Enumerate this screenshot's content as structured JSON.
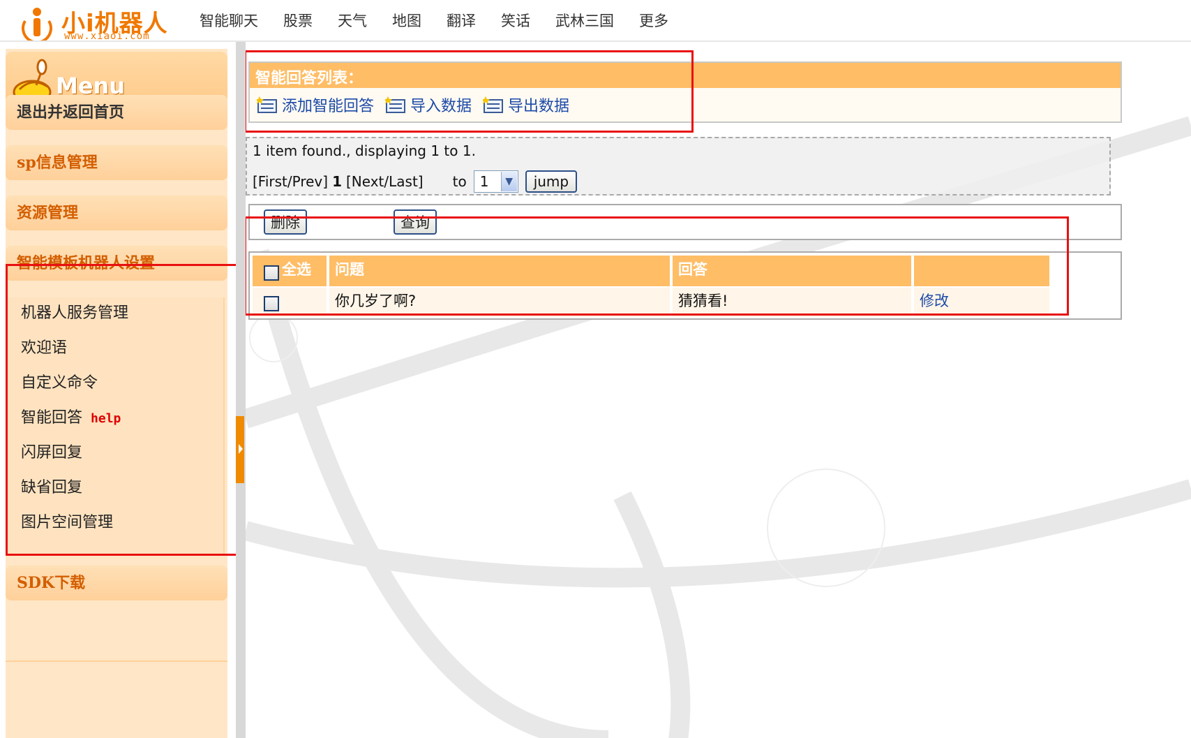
{
  "brand": {
    "name": "小i机器人",
    "url": "www.xiaoi.com",
    "color": "#f07800"
  },
  "topnav": [
    "智能聊天",
    "股票",
    "天气",
    "地图",
    "翻译",
    "笑话",
    "武林三国",
    "更多"
  ],
  "sidebar": {
    "menu_label": "Menu",
    "logout": "退出并返回首页",
    "sp_info": "sp信息管理",
    "resources": "资源管理",
    "robot_settings": "智能模板机器人设置",
    "sub_items": [
      {
        "label": "机器人服务管理"
      },
      {
        "label": "欢迎语"
      },
      {
        "label": "自定义命令"
      },
      {
        "label": "智能回答",
        "tag": "help"
      },
      {
        "label": "闪屏回复"
      },
      {
        "label": "缺省回复"
      },
      {
        "label": "图片空间管理"
      }
    ],
    "sdk": "SDK下载"
  },
  "list": {
    "title": "智能回答列表：",
    "toolbar": {
      "add": "添加智能回答",
      "import": "导入数据",
      "export": "导出数据"
    }
  },
  "pager": {
    "summary": "1 item found., displaying 1 to 1.",
    "first_prev": "[First/Prev]",
    "current": "1",
    "next_last": "[Next/Last]",
    "to_label": "to",
    "page_value": "1",
    "jump_label": "jump"
  },
  "actions": {
    "delete": "删除",
    "query": "查询"
  },
  "table": {
    "headers": {
      "select_all": "全选",
      "question": "问题",
      "answer": "回答",
      "ops": ""
    },
    "rows": [
      {
        "question": "你几岁了啊?",
        "answer": "猜猜看!",
        "edit": "修改"
      }
    ]
  },
  "colors": {
    "accent": "#ffbd66",
    "link": "#1c4aa8",
    "highlight_box": "#e81010",
    "help": "#e00000"
  }
}
